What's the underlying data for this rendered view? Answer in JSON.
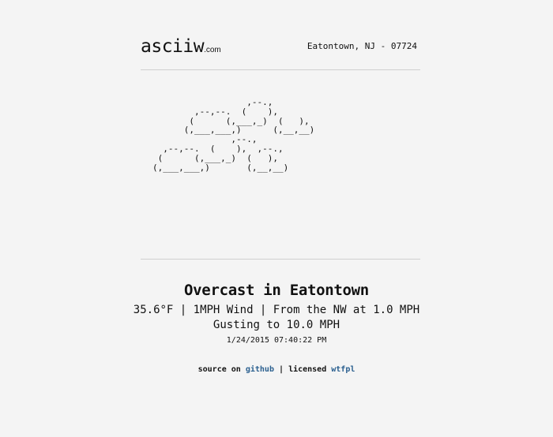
{
  "header": {
    "logo_main": "asciiw",
    "logo_tld": ".com",
    "location": "Eatontown, NJ - 07724"
  },
  "ascii_art": "                  ,--.,\n        ,--,--.  (    ),\n       (      (,___,_)  (   ),\n      (,___,___,)      (,__,__)\n               ,--.,\n  ,--,--.  (    ),  ,--.,\n (      (,___,_)  (   ),\n(,___,___,)       (,__,__)",
  "weather": {
    "headline": "Overcast in Eatontown",
    "line1": "35.6°F | 1MPH Wind | From the NW at 1.0 MPH",
    "line2": "Gusting to 10.0 MPH",
    "timestamp": "1/24/2015 07:40:22 PM"
  },
  "footer": {
    "source_prefix": "source on",
    "github_label": "github",
    "separator": "|",
    "licensed_label": "licensed",
    "license_link": "wtfpl"
  },
  "colors": {
    "background": "#f4f4f4",
    "link": "#2a5f8f",
    "rule": "#cfcfcf"
  }
}
